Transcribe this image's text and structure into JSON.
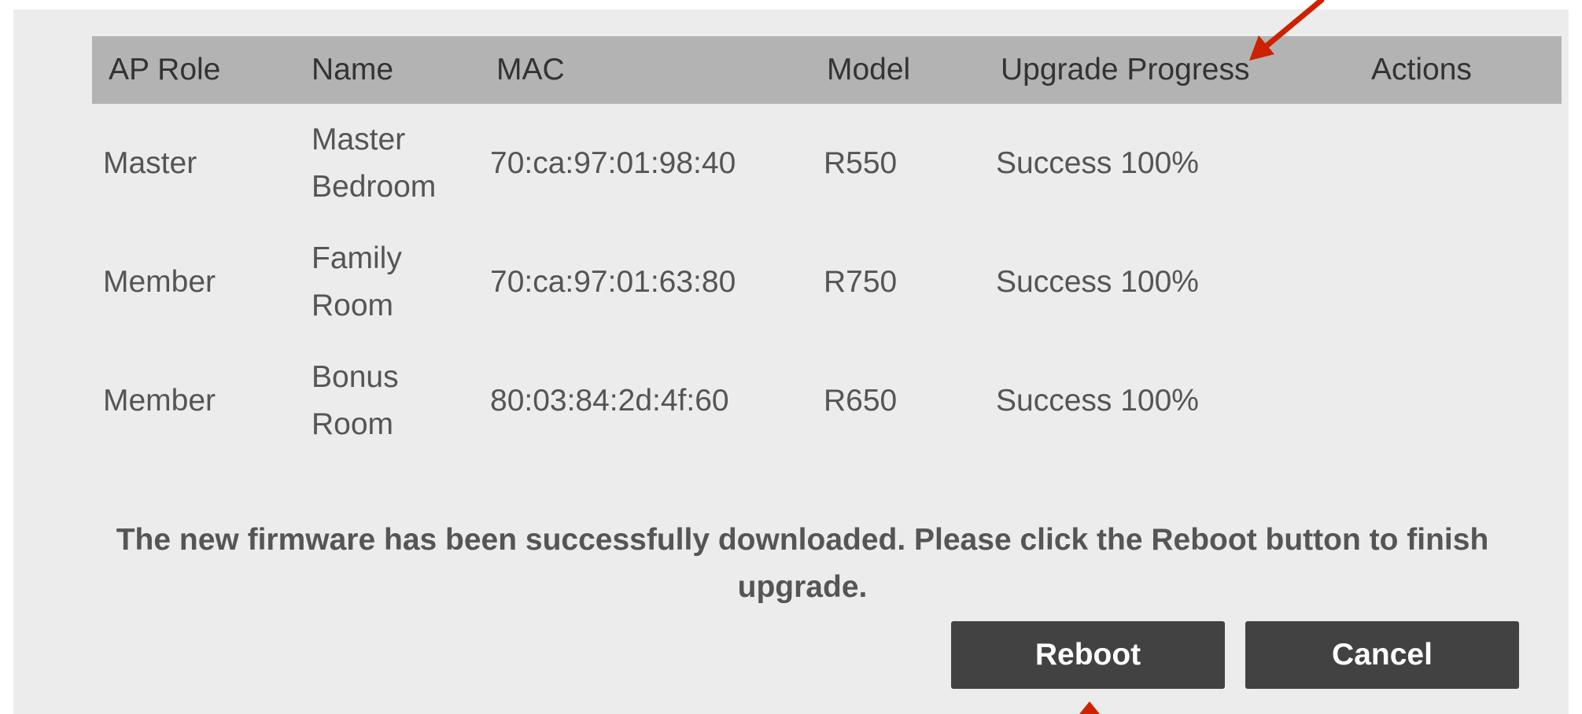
{
  "table": {
    "headers": {
      "role": "AP Role",
      "name": "Name",
      "mac": "MAC",
      "model": "Model",
      "progress": "Upgrade Progress",
      "actions": "Actions"
    },
    "rows": [
      {
        "role": "Master",
        "name": "Master Bedroom",
        "mac": "70:ca:97:01:98:40",
        "model": "R550",
        "progress": "Success 100%",
        "actions": ""
      },
      {
        "role": "Member",
        "name": "Family Room",
        "mac": "70:ca:97:01:63:80",
        "model": "R750",
        "progress": "Success 100%",
        "actions": ""
      },
      {
        "role": "Member",
        "name": "Bonus Room",
        "mac": "80:03:84:2d:4f:60",
        "model": "R650",
        "progress": "Success 100%",
        "actions": ""
      }
    ]
  },
  "message": "The new firmware has been successfully downloaded. Please click the Reboot button to finish upgrade.",
  "buttons": {
    "reboot": "Reboot",
    "cancel": "Cancel"
  },
  "colors": {
    "panel_bg": "#ececec",
    "header_bg": "#b3b3b3",
    "button_bg": "#424242",
    "annotation_arrow": "#cc2200"
  },
  "annotations": [
    {
      "icon": "annotation-arrow-icon",
      "target": "progress-header"
    },
    {
      "icon": "annotation-arrow-icon",
      "target": "reboot-button"
    }
  ]
}
